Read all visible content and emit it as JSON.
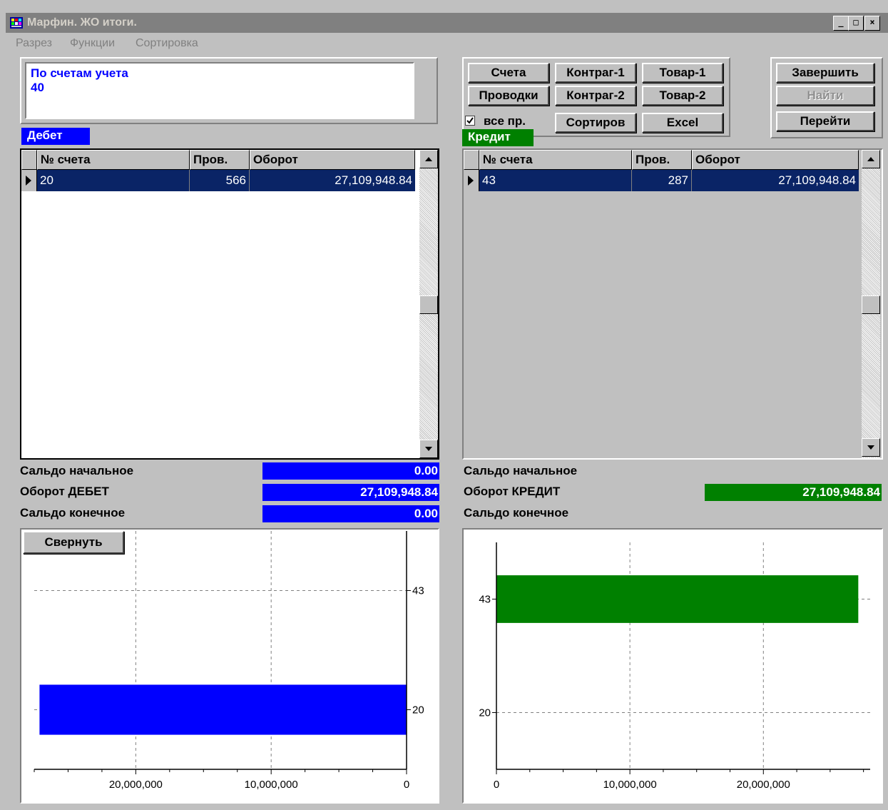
{
  "window": {
    "title": "Марфин. ЖО итоги.",
    "controls": {
      "minimize": "_",
      "maximize": "□",
      "close": "×"
    }
  },
  "menu": [
    "Разрез",
    "Функции",
    "Сортировка"
  ],
  "memo": {
    "line1": "По счетам учета",
    "line2": "40"
  },
  "toolbar": {
    "schet": "Счета",
    "provodki": "Проводки",
    "kontrag1": "Контраг-1",
    "kontrag2": "Контраг-2",
    "tovar1": "Товар-1",
    "tovar2": "Товар-2",
    "sortirov": "Сортиров",
    "excel": "Excel",
    "zavershit": "Завершить",
    "nayti": "Найти",
    "pereyti": "Перейти",
    "vse_pr_label": "все пр.",
    "vse_pr_checked": true
  },
  "debit": {
    "tag": "Дебет",
    "tag_color": "#0000ff",
    "columns": [
      "№ счета",
      "Пров.",
      "Оборот"
    ],
    "rows": [
      {
        "account": "20",
        "count": "566",
        "turnover": "27,109,948.84"
      }
    ],
    "summary": {
      "opening_label": "Сальдо начальное",
      "opening_value": "0.00",
      "turnover_label": "Оборот ДЕБЕТ",
      "turnover_value": "27,109,948.84",
      "closing_label": "Сальдо конечное",
      "closing_value": "0.00"
    },
    "collapse_button": "Свернуть"
  },
  "credit": {
    "tag": "Кредит",
    "tag_color": "#008000",
    "columns": [
      "№ счета",
      "Пров.",
      "Оборот"
    ],
    "rows": [
      {
        "account": "43",
        "count": "287",
        "turnover": "27,109,948.84"
      }
    ],
    "summary": {
      "opening_label": "Сальдо начальное",
      "turnover_label": "Оборот КРЕДИТ",
      "turnover_value": "27,109,948.84",
      "closing_label": "Сальдо конечное"
    }
  },
  "chart_data": [
    {
      "type": "bar",
      "orientation": "horizontal",
      "x_reversed": true,
      "categories": [
        "20",
        "43"
      ],
      "values": [
        27109948.84,
        0
      ],
      "xlim": [
        0,
        27500000
      ],
      "x_ticks": [
        "0",
        "10,000,000",
        "20,000,000"
      ],
      "grid": true,
      "color": "#0000ff"
    },
    {
      "type": "bar",
      "orientation": "horizontal",
      "x_reversed": false,
      "categories": [
        "20",
        "43"
      ],
      "values": [
        0,
        27109948.84
      ],
      "xlim": [
        0,
        28000000
      ],
      "x_ticks": [
        "0",
        "10,000,000",
        "20,000,000"
      ],
      "grid": true,
      "color": "#008000"
    }
  ]
}
